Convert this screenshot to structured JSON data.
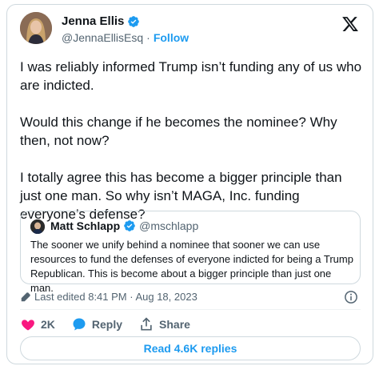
{
  "author": {
    "name": "Jenna Ellis",
    "handle": "@JennaEllisEsq",
    "follow_label": "Follow"
  },
  "tweet": {
    "text": "I was reliably informed Trump isn’t funding any of us who are indicted.\n\nWould this change if he becomes the nominee? Why then, not now?\n\nI totally agree this has become a bigger principle than just one man. So why isn’t MAGA, Inc. funding everyone’s defense?"
  },
  "quoted": {
    "name": "Matt Schlapp",
    "handle": "@mschlapp",
    "text": "The sooner we unify behind a nominee that sooner we can use resources to fund the defenses of everyone indicted for being a Trump Republican. This is become about a bigger principle than just one man."
  },
  "meta": {
    "edited": "Last edited 8:41 PM · Aug 18, 2023"
  },
  "actions": {
    "likes": "2K",
    "reply_label": "Reply",
    "share_label": "Share"
  },
  "read_replies_label": "Read 4.6K replies",
  "colors": {
    "accent": "#1d9bf0",
    "heart": "#f91880",
    "text": "#0f1419",
    "secondary": "#536471",
    "border": "#cfd9de"
  },
  "icons": [
    "verified-badge-icon",
    "x-logo-icon",
    "pencil-icon",
    "info-icon",
    "heart-icon",
    "reply-bubble-icon",
    "share-icon"
  ]
}
